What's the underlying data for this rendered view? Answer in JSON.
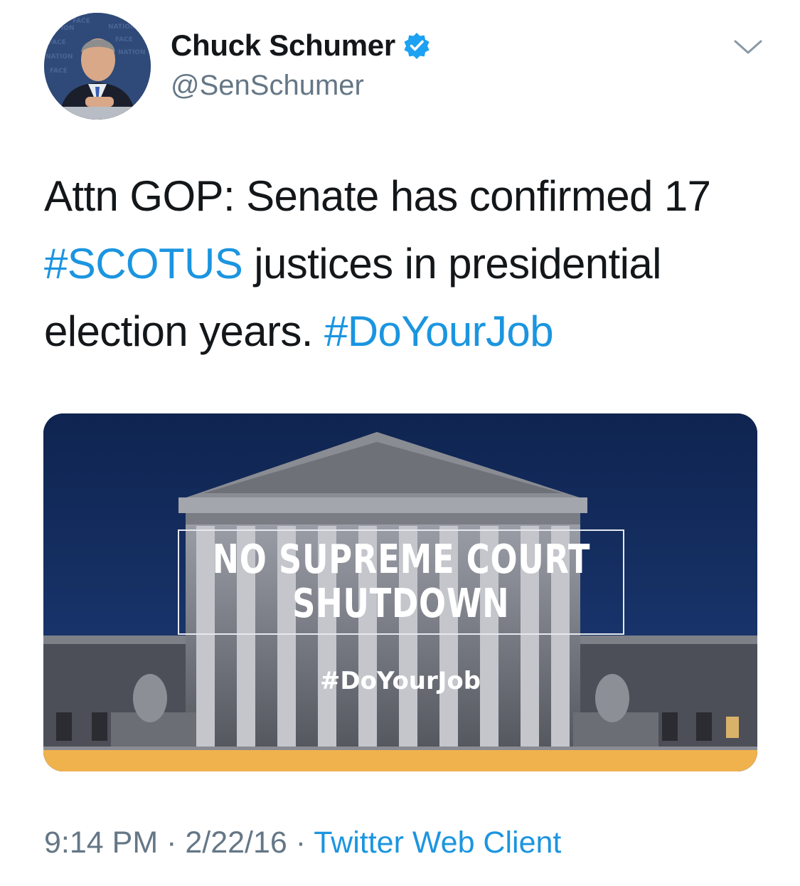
{
  "author": {
    "display_name": "Chuck Schumer",
    "handle": "@SenSchumer",
    "verified": true,
    "avatar_icon": "profile-photo"
  },
  "tweet": {
    "text_parts": [
      {
        "text": "Attn GOP: Senate has confirmed 17 ",
        "type": "text"
      },
      {
        "text": "#SCOTUS",
        "type": "hashtag"
      },
      {
        "text": " justices in presidential election years. ",
        "type": "text"
      },
      {
        "text": "#DoYourJob",
        "type": "hashtag"
      }
    ]
  },
  "media": {
    "banner_line1": "NO SUPREME COURT",
    "banner_line2": "SHUTDOWN",
    "hashtag": "#DoYourJob",
    "bar_color": "#f0b24c"
  },
  "meta": {
    "time": "9:14 PM",
    "separator1": " · ",
    "date": "2/22/16",
    "separator2": " · ",
    "source": "Twitter Web Client"
  },
  "colors": {
    "link": "#1b95e0",
    "secondary_text": "#657786",
    "verified_badge": "#1da1f2"
  }
}
